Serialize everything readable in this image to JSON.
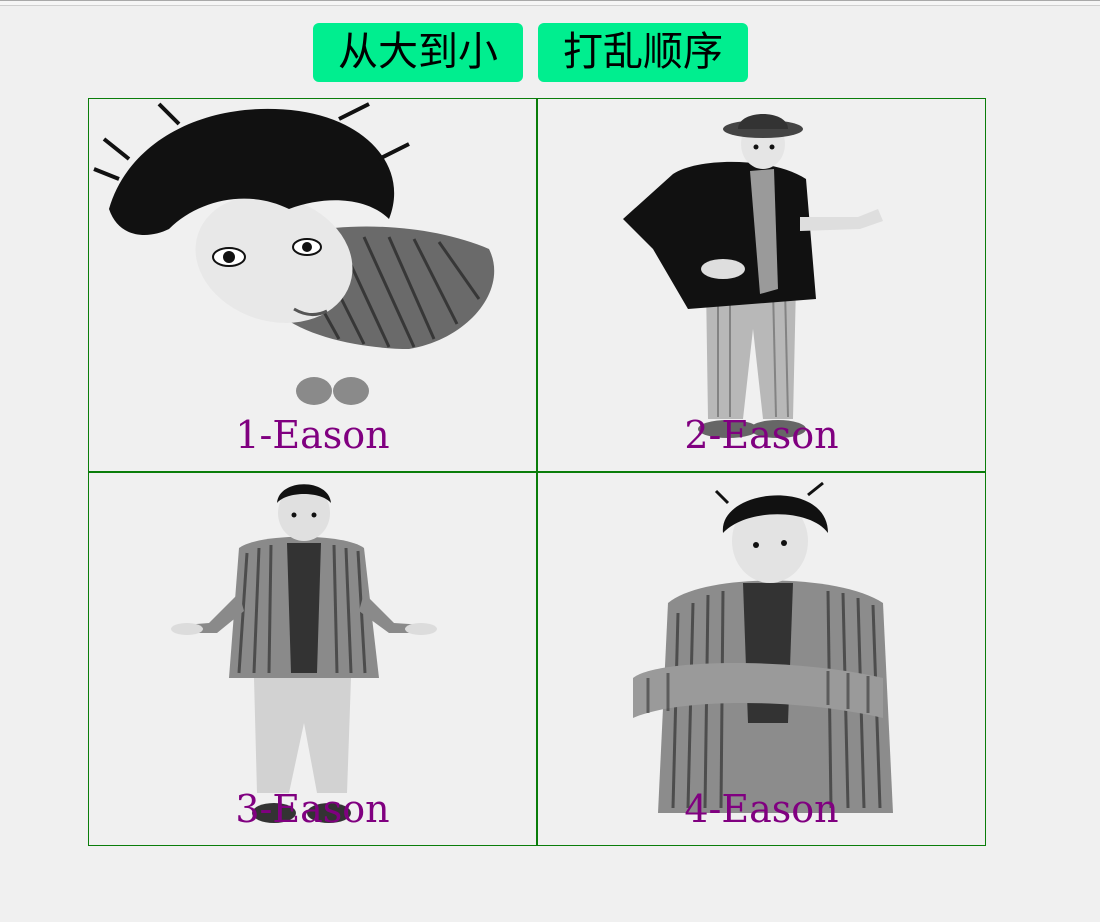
{
  "toolbar": {
    "sort_label": "从大到小",
    "shuffle_label": "打乱顺序"
  },
  "gallery": {
    "items": [
      {
        "caption": "1-Eason"
      },
      {
        "caption": "2-Eason"
      },
      {
        "caption": "3-Eason"
      },
      {
        "caption": "4-Eason"
      }
    ]
  },
  "colors": {
    "button_bg": "#00ee8f",
    "cell_border": "#0a7d0a",
    "caption": "#800080",
    "background": "#f0f0f0"
  }
}
